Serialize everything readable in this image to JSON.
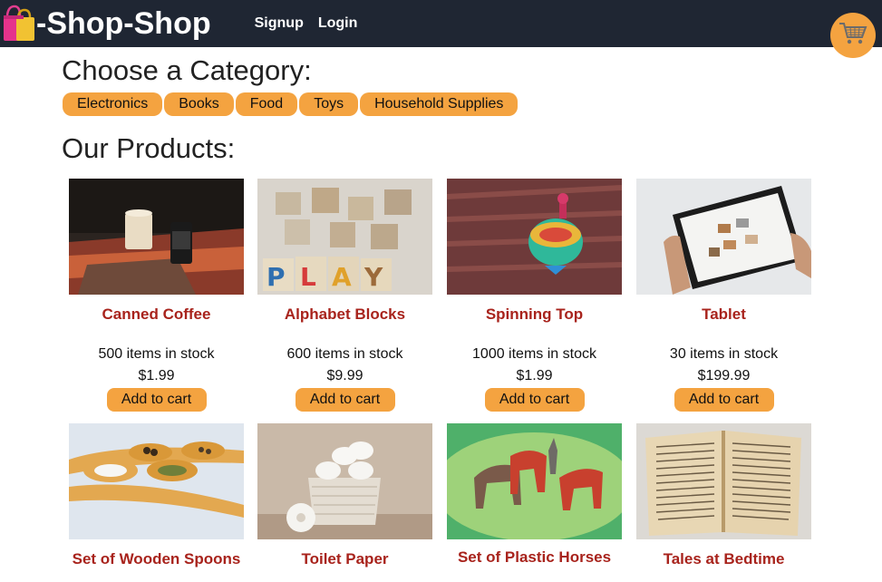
{
  "header": {
    "brand_icon": "shopping-bags-icon",
    "brand": "-Shop-Shop",
    "nav": [
      "Signup",
      "Login"
    ],
    "cart_icon": "shopping-cart-icon"
  },
  "categories": {
    "heading": "Choose a Category:",
    "items": [
      "Electronics",
      "Books",
      "Food",
      "Toys",
      "Household Supplies"
    ]
  },
  "products": {
    "heading": "Our Products:",
    "add_label": "Add to cart",
    "items": [
      {
        "name": "Canned Coffee",
        "stock": "500 items in stock",
        "price": "$1.99"
      },
      {
        "name": "Alphabet Blocks",
        "stock": "600 items in stock",
        "price": "$9.99"
      },
      {
        "name": "Spinning Top",
        "stock": "1000 items in stock",
        "price": "$1.99"
      },
      {
        "name": "Tablet",
        "stock": "30 items in stock",
        "price": "$199.99"
      },
      {
        "name": "Set of Wooden Spoons"
      },
      {
        "name": "Toilet Paper"
      },
      {
        "name": "Set of Plastic Horses"
      },
      {
        "name": "Tales at Bedtime"
      }
    ]
  },
  "colors": {
    "nav_bg": "#1f2633",
    "accent": "#f4a340",
    "product_name": "#a8231c"
  }
}
